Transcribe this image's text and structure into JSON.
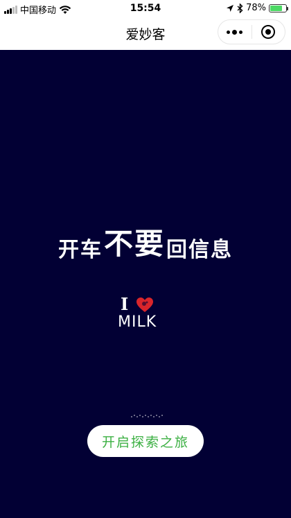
{
  "status_bar": {
    "carrier": "中国移动",
    "time": "15:54",
    "battery_percent": "78%",
    "battery_level": 0.78,
    "icons": [
      "signal-icon",
      "wifi-icon",
      "location-arrow-icon",
      "bluetooth-icon",
      "battery-icon"
    ]
  },
  "nav": {
    "title": "爱妙客",
    "icons": [
      "more-dots-icon",
      "close-target-icon"
    ]
  },
  "main": {
    "background_color": "#020034",
    "slogan": {
      "part1": "开车",
      "part2": "不要",
      "part3": "回信息"
    },
    "logo": {
      "letter": "I",
      "word": "MILK",
      "heart_color": "#d9252b"
    },
    "cta_label": "开启探索之旅",
    "cta_color": "#3cb043"
  }
}
